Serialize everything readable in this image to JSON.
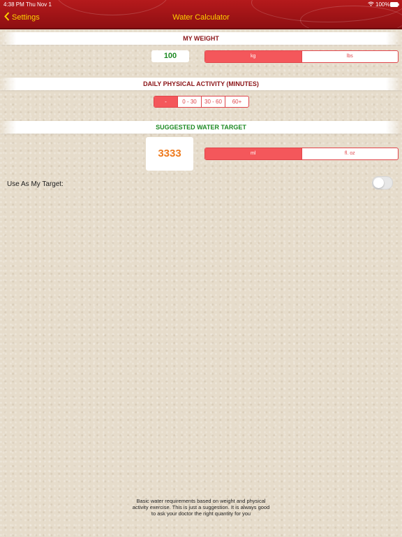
{
  "status_bar": {
    "time": "4:38 PM",
    "date": "Thu Nov 1",
    "battery": "100%"
  },
  "nav": {
    "back_label": "Settings",
    "title": "Water Calculator"
  },
  "weight": {
    "header": "MY WEIGHT",
    "value": "100",
    "units": [
      {
        "label": "kg",
        "selected": true
      },
      {
        "label": "lbs",
        "selected": false
      }
    ]
  },
  "activity": {
    "header": "DAILY PHYSICAL ACTIVITY (MINUTES)",
    "options": [
      {
        "label": "-",
        "selected": true
      },
      {
        "label": "0 - 30",
        "selected": false
      },
      {
        "label": "30 - 60",
        "selected": false
      },
      {
        "label": "60+",
        "selected": false
      }
    ]
  },
  "target": {
    "header": "SUGGESTED WATER TARGET",
    "value": "3333",
    "units": [
      {
        "label": "ml",
        "selected": true
      },
      {
        "label": "fl. oz",
        "selected": false
      }
    ]
  },
  "use_as_target": {
    "label": "Use As My Target:",
    "enabled": false
  },
  "footnote": "Basic water requirements based on weight and physical activity exercise. This is just a suggestion. It is always good to ask your doctor the right quantity for you",
  "colors": {
    "nav_bg": "#a3151a",
    "nav_text": "#ffd200",
    "accent": "#f4575b",
    "header_weight": "#8b1417",
    "header_target": "#1d8a23",
    "weight_value": "#1d8a23",
    "target_value": "#ee7b1f"
  }
}
